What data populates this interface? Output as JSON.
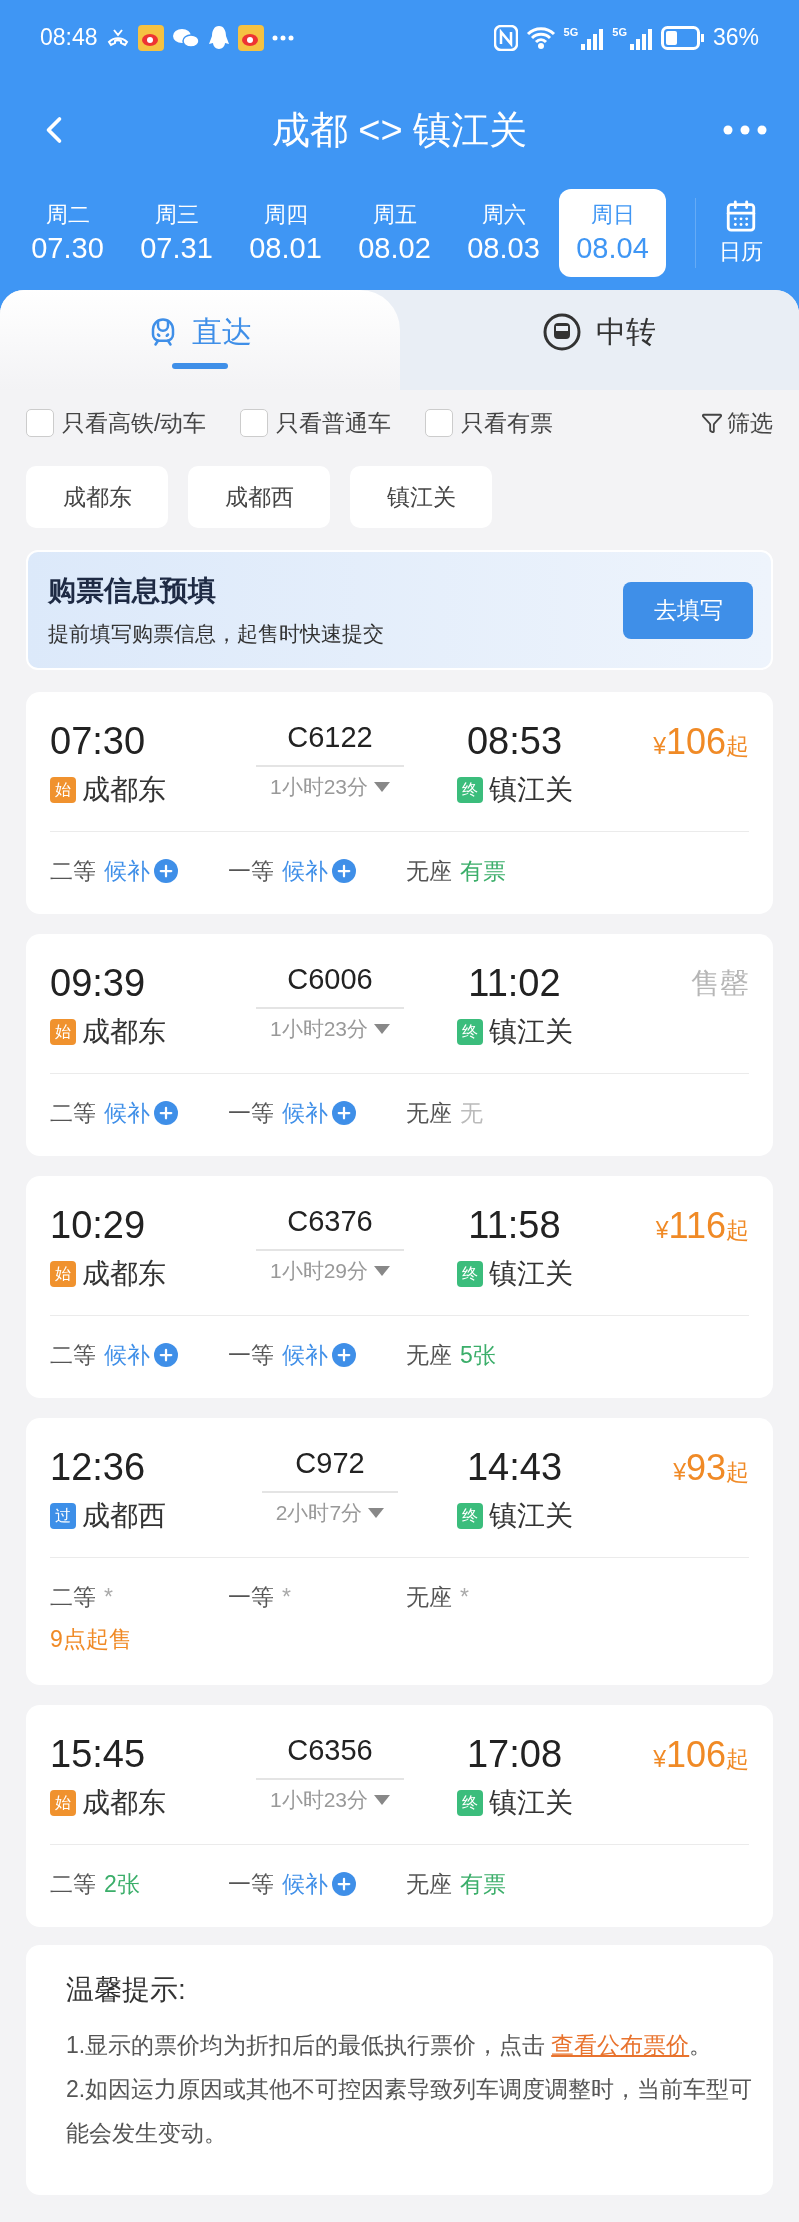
{
  "status_bar": {
    "time": "08:48",
    "network_labels": [
      "5G",
      "5G"
    ],
    "battery": "36%"
  },
  "header": {
    "title": "成都 <> 镇江关"
  },
  "dates": [
    {
      "weekday": "周二",
      "date": "07.30",
      "selected": false
    },
    {
      "weekday": "周三",
      "date": "07.31",
      "selected": false
    },
    {
      "weekday": "周四",
      "date": "08.01",
      "selected": false
    },
    {
      "weekday": "周五",
      "date": "08.02",
      "selected": false
    },
    {
      "weekday": "周六",
      "date": "08.03",
      "selected": false
    },
    {
      "weekday": "周日",
      "date": "08.04",
      "selected": true
    }
  ],
  "calendar": {
    "label": "日历"
  },
  "tabs": [
    {
      "label": "直达",
      "kind": "direct",
      "selected": true
    },
    {
      "label": "中转",
      "kind": "transfer",
      "selected": false
    }
  ],
  "filters": [
    {
      "label": "只看高铁/动车",
      "checked": false
    },
    {
      "label": "只看普通车",
      "checked": false
    },
    {
      "label": "只看有票",
      "checked": false
    }
  ],
  "filter_button": {
    "label": "筛选"
  },
  "stations": [
    "成都东",
    "成都西",
    "镇江关"
  ],
  "prefill": {
    "title": "购票信息预填",
    "subtitle": "提前填写购票信息，起售时快速提交",
    "button": "去填写"
  },
  "trains": [
    {
      "depart_time": "07:30",
      "origin_badge": {
        "label": "始",
        "color": "#f0922e"
      },
      "origin": "成都东",
      "code": "C6122",
      "duration": "1小时23分",
      "arrive_time": "08:53",
      "dest_badge": {
        "label": "终",
        "color": "#3bbd7c"
      },
      "destination": "镇江关",
      "price": {
        "kind": "price",
        "symbol": "¥",
        "amount": "106",
        "suffix": "起"
      },
      "seats": [
        {
          "class": "二等",
          "kind": "waitlist",
          "status": "候补"
        },
        {
          "class": "一等",
          "kind": "waitlist",
          "status": "候补"
        },
        {
          "class": "无座",
          "kind": "available",
          "status": "有票"
        }
      ]
    },
    {
      "depart_time": "09:39",
      "origin_badge": {
        "label": "始",
        "color": "#f0922e"
      },
      "origin": "成都东",
      "code": "C6006",
      "duration": "1小时23分",
      "arrive_time": "11:02",
      "dest_badge": {
        "label": "终",
        "color": "#3bbd7c"
      },
      "destination": "镇江关",
      "price": {
        "kind": "sold_out",
        "text": "售罄"
      },
      "seats": [
        {
          "class": "二等",
          "kind": "waitlist",
          "status": "候补"
        },
        {
          "class": "一等",
          "kind": "waitlist",
          "status": "候补"
        },
        {
          "class": "无座",
          "kind": "none",
          "status": "无"
        }
      ]
    },
    {
      "depart_time": "10:29",
      "origin_badge": {
        "label": "始",
        "color": "#f0922e"
      },
      "origin": "成都东",
      "code": "C6376",
      "duration": "1小时29分",
      "arrive_time": "11:58",
      "dest_badge": {
        "label": "终",
        "color": "#3bbd7c"
      },
      "destination": "镇江关",
      "price": {
        "kind": "price",
        "symbol": "¥",
        "amount": "116",
        "suffix": "起"
      },
      "seats": [
        {
          "class": "二等",
          "kind": "waitlist",
          "status": "候补"
        },
        {
          "class": "一等",
          "kind": "waitlist",
          "status": "候补"
        },
        {
          "class": "无座",
          "kind": "available",
          "status": "5张"
        }
      ]
    },
    {
      "depart_time": "12:36",
      "origin_badge": {
        "label": "过",
        "color": "#3d8fe8"
      },
      "origin": "成都西",
      "code": "C972",
      "duration": "2小时7分",
      "arrive_time": "14:43",
      "dest_badge": {
        "label": "终",
        "color": "#3bbd7c"
      },
      "destination": "镇江关",
      "price": {
        "kind": "price",
        "symbol": "¥",
        "amount": "93",
        "suffix": "起"
      },
      "seats": [
        {
          "class": "二等",
          "kind": "pending",
          "status": "*"
        },
        {
          "class": "一等",
          "kind": "pending",
          "status": "*"
        },
        {
          "class": "无座",
          "kind": "pending",
          "status": "*"
        }
      ],
      "sale_note": "9点起售"
    },
    {
      "depart_time": "15:45",
      "origin_badge": {
        "label": "始",
        "color": "#f0922e"
      },
      "origin": "成都东",
      "code": "C6356",
      "duration": "1小时23分",
      "arrive_time": "17:08",
      "dest_badge": {
        "label": "终",
        "color": "#3bbd7c"
      },
      "destination": "镇江关",
      "price": {
        "kind": "price",
        "symbol": "¥",
        "amount": "106",
        "suffix": "起"
      },
      "seats": [
        {
          "class": "二等",
          "kind": "available",
          "status": "2张"
        },
        {
          "class": "一等",
          "kind": "waitlist",
          "status": "候补"
        },
        {
          "class": "无座",
          "kind": "available",
          "status": "有票"
        }
      ]
    }
  ],
  "tips": {
    "title": "温馨提示:",
    "items": [
      {
        "text": "1.显示的票价均为折扣后的最低执行票价，点击",
        "link": "查看公布票价",
        "after": "。"
      },
      {
        "text": "2.如因运力原因或其他不可控因素导致列车调度调整时，当前车型可能会发生变动。"
      }
    ]
  }
}
